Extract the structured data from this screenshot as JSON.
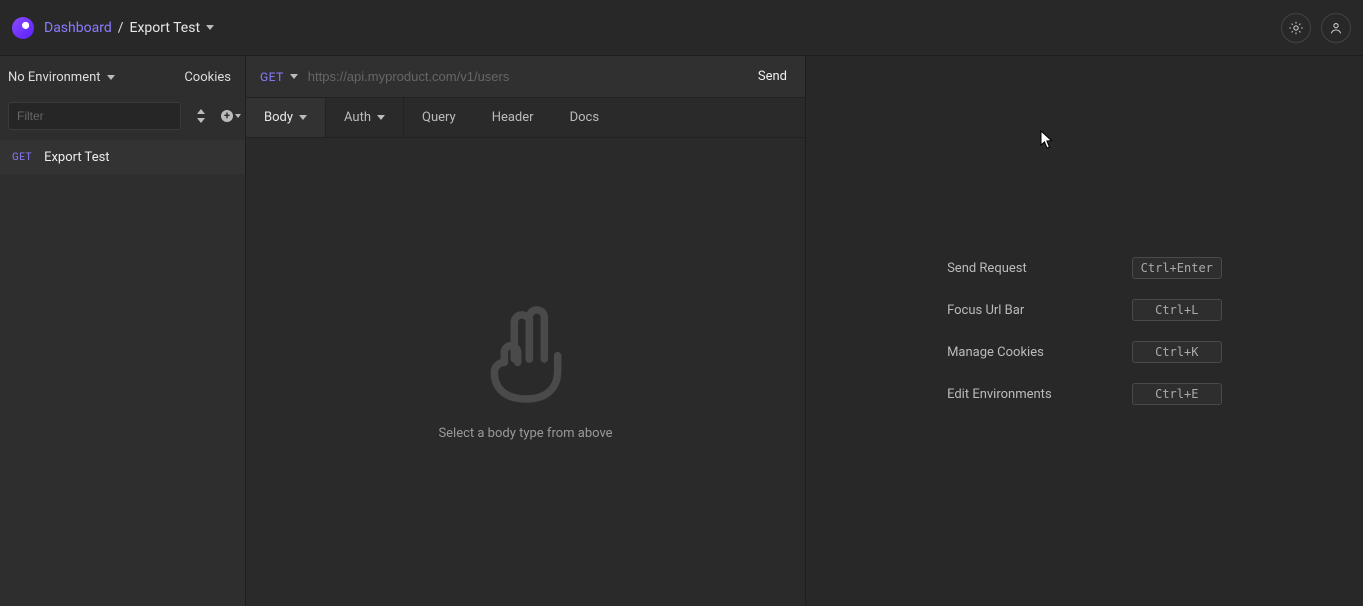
{
  "header": {
    "dashboard_label": "Dashboard",
    "separator": "/",
    "workspace_name": "Export Test"
  },
  "sidebar": {
    "environment_label": "No Environment",
    "cookies_label": "Cookies",
    "filter_placeholder": "Filter",
    "requests": [
      {
        "method": "GET",
        "name": "Export Test"
      }
    ]
  },
  "request": {
    "method": "GET",
    "url_placeholder": "https://api.myproduct.com/v1/users",
    "url_value": "",
    "send_label": "Send",
    "tabs": {
      "body": "Body",
      "auth": "Auth",
      "query": "Query",
      "header": "Header",
      "docs": "Docs"
    },
    "body_empty_hint": "Select a body type from above"
  },
  "shortcuts": [
    {
      "label": "Send Request",
      "keys": "Ctrl+Enter"
    },
    {
      "label": "Focus Url Bar",
      "keys": "Ctrl+L"
    },
    {
      "label": "Manage Cookies",
      "keys": "Ctrl+K"
    },
    {
      "label": "Edit Environments",
      "keys": "Ctrl+E"
    }
  ]
}
